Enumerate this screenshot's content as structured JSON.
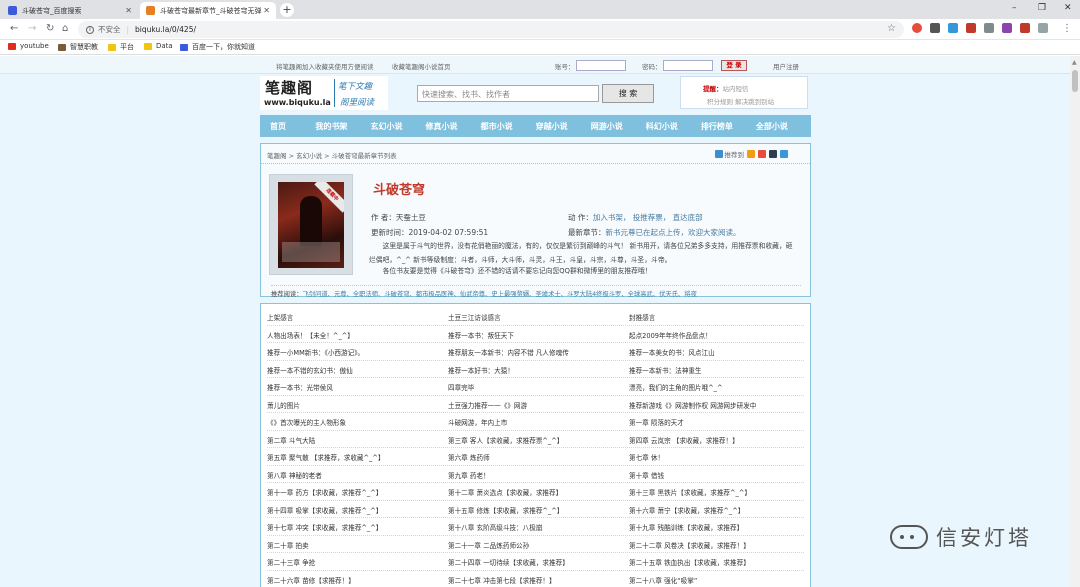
{
  "browser": {
    "tabs": [
      {
        "title": "斗破苍穹_百度搜索",
        "active": false
      },
      {
        "title": "斗破苍穹最新章节_斗破苍穹无弹",
        "active": true
      }
    ],
    "new_tab": "+",
    "address": {
      "security": "不安全",
      "url": "biquku.la/0/425/"
    },
    "bookmarks": [
      {
        "label": "youtube",
        "color": "#e02b20"
      },
      {
        "label": "智慧职教",
        "color": "#7b5a3a"
      },
      {
        "label": "平台",
        "color": "#f1c40f"
      },
      {
        "label": "Data",
        "color": "#f1c40f"
      },
      {
        "label": "百度一下，你就知道",
        "color": "#3b5bdb"
      }
    ]
  },
  "topbar": {
    "left_link1": "将笔趣阁加入收藏夹使用方便阅读",
    "left_link2": "收藏笔趣阁小说首页",
    "account_label": "账号：",
    "password_label": "密码：",
    "login_btn": "登 录",
    "register": "用户注册"
  },
  "header": {
    "logo_title": "笔趣阁",
    "logo_url": "www.biquku.la",
    "slogan1": "笔下文趣",
    "slogan2": "阁里阅读",
    "search_placeholder": "快速搜索、找书、找作者",
    "search_btn": "搜 索",
    "hint_label": "提醒：",
    "hint_text": "站内短信",
    "hint_line2": "积分规则   解决跳到别站"
  },
  "nav": [
    "首页",
    "我的书架",
    "玄幻小说",
    "修真小说",
    "都市小说",
    "穿越小说",
    "网游小说",
    "科幻小说",
    "排行榜单",
    "全部小说"
  ],
  "book": {
    "breadcrumb": "笔趣阁  >  玄幻小说  >  斗破苍穹最新章节列表",
    "tools_label": "推荐到",
    "cover_ribbon": "连载中",
    "title": "斗破苍穹",
    "author_label": "作      者：",
    "author": "天蚕土豆",
    "action_label": "动      作：",
    "actions": "加入书架，  投推荐票，  直达底部",
    "updated_label": "更新时间：",
    "updated": "2019-04-02 07:59:51",
    "latest_label": "最新章节：",
    "latest": "新书元尊已在起点上传，欢迎大家阅读。",
    "intro": "这里是属于斗气的世界，没有花俏艳丽的魔法，有的，仅仅是繁衍到巅峰的斗气！  新书用开，请各位兄弟多多支持，用推荐票和收藏，砸烂偶吧，^_^  新书等级制度：斗者，斗师，大斗师，斗灵，斗王，斗皇，斗宗，斗尊，斗圣，斗帝。",
    "intro2": "各位书友要是觉得《斗破苍穹》还不错的话请不要忘记向您QQ群和微博里的朋友推荐哦！",
    "recs_label": "推荐阅读：",
    "recs": "飞剑问道、元尊、全职法师、斗破苍穹、都市极品医神、仙武帝尊、史上最强赘婿、圣墟术士、斗罗大陆4终极斗罗、全球高武、伏天氏、将夜"
  },
  "chapters": [
    [
      "上架感言",
      "土豆三江访谈感言",
      "封推感言"
    ],
    [
      "人物出场表！【未全！^_^】",
      "推荐一本书：叛狂天下",
      "起点2009年年终作品盘点！"
    ],
    [
      "推荐一小MM新书：《小西游记》。",
      "推荐朋友一本新书：内容不错 凡人修魂传",
      "推荐一本美女的书：风点江山"
    ],
    [
      "推荐一本不错的玄幻书：傲仙",
      "推荐一本好书：大猿！",
      "推荐一本新书：法神重生"
    ],
    [
      "推荐一本书：光带侯风",
      "四章完毕",
      "漂亮，我们的主角的图片哦^_^"
    ],
    [
      "萧儿的图片",
      "土豆强力推荐一一《》网游",
      "推荐新游戏《》网游制作权 网游网步研发中"
    ],
    [
      "《》首次曝光的主人物形象",
      "斗破网游，年内上市",
      "第一章 陨落的天才"
    ],
    [
      "第二章 斗气大陆",
      "第三章 客人【求收藏，求推荐票^_^】",
      "第四章 云岚宗 【求收藏，求推荐！】"
    ],
    [
      "第五章 聚气散 【求推荐，求收藏^_^】",
      "第六章 炼药师",
      "第七章 休！"
    ],
    [
      "第八章 神秘的老者",
      "第九章 药老！",
      "第十章 借钱"
    ],
    [
      "第十一章 药方【求收藏，求推荐^_^】",
      "第十二章 萧炎选点【求收藏，求推荐】",
      "第十三章 黑铁片【求收藏，求推荐^_^】"
    ],
    [
      "第十四章 吸掌【求收藏，求推荐^_^】",
      "第十五章 修炼【求收藏，求推荐^_^】",
      "第十六章 萧宁【求收藏，求推荐^_^】"
    ],
    [
      "第十七章 冲突【求收藏，求推荐^_^】",
      "第十八章 玄阶高级斗技：八极崩",
      "第十九章 残酷训练【求收藏，求推荐】"
    ],
    [
      "第二十章 拍卖",
      "第二十一章 二品炼药师公孙",
      "第二十二章 风卷决【求收藏，求推荐！】"
    ],
    [
      "第二十三章 争抢",
      "第二十四章 一切待续【求收藏，求推荐】",
      "第二十五章 铁血执出【求收藏，求推荐】"
    ],
    [
      "第二十六章 苗修【求推荐！】",
      "第二十七章 冲击第七段【求推荐！】",
      "第二十八章 强化“吸掌”"
    ]
  ],
  "watermark": "信安灯塔",
  "colors": {
    "accent": "#7fc0df",
    "page_bg": "#e9f6fd",
    "title": "#c0392b",
    "link": "#3a7ca5"
  }
}
